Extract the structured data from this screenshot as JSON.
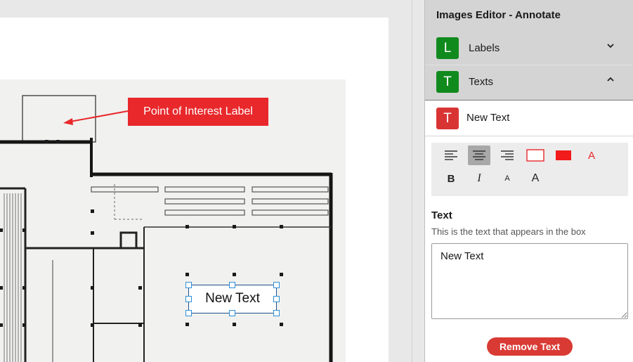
{
  "panel": {
    "title": "Images Editor - Annotate",
    "accordion": [
      {
        "badge": "L",
        "label": "Labels",
        "state": "collapsed",
        "color": "#118a1d"
      },
      {
        "badge": "T",
        "label": "Texts",
        "state": "expanded",
        "color": "#118a1d"
      }
    ],
    "selected_item": {
      "badge": "T",
      "label": "New Text",
      "color": "#d93434"
    },
    "toolbar": {
      "tools": [
        {
          "name": "align-left-icon",
          "active": false
        },
        {
          "name": "align-center-icon",
          "active": true
        },
        {
          "name": "align-right-icon",
          "active": false
        },
        {
          "name": "border-color-icon",
          "active": false
        },
        {
          "name": "fill-color-icon",
          "active": false
        },
        {
          "name": "font-color-icon",
          "label": "A",
          "active": false
        },
        {
          "name": "bold-icon",
          "label": "B",
          "active": false
        },
        {
          "name": "italic-icon",
          "label": "I",
          "active": false
        },
        {
          "name": "font-size-small-icon",
          "label": "A",
          "active": false
        },
        {
          "name": "font-size-large-icon",
          "label": "A",
          "active": false
        }
      ]
    },
    "field": {
      "title": "Text",
      "help": "This is the text that appears in the box",
      "value": "New Text"
    },
    "remove_button": "Remove Text"
  },
  "canvas": {
    "annotation_label": "Point of Interest Label",
    "text_box": "New Text"
  },
  "colors": {
    "accent_red": "#e8282b",
    "badge_green": "#118a1d",
    "selection_blue": "#2f8fd6"
  }
}
